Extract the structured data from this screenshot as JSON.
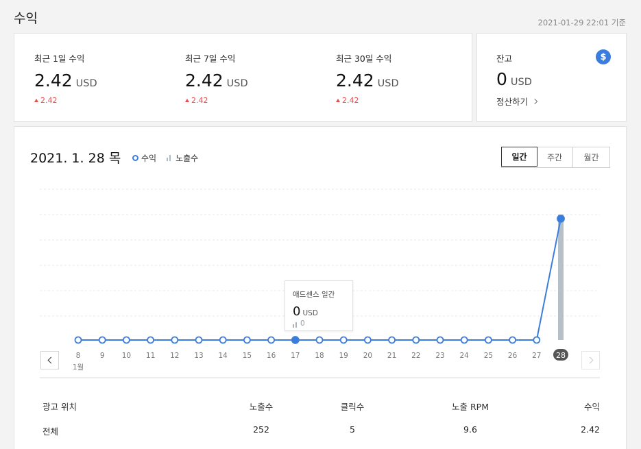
{
  "header": {
    "title": "수익",
    "timestamp": "2021-01-29 22:01 기준"
  },
  "summary": [
    {
      "label": "최근 1일 수익",
      "value": "2.42",
      "unit": "USD",
      "delta": "2.42"
    },
    {
      "label": "최근 7일 수익",
      "value": "2.42",
      "unit": "USD",
      "delta": "2.42"
    },
    {
      "label": "최근 30일 수익",
      "value": "2.42",
      "unit": "USD",
      "delta": "2.42"
    }
  ],
  "balance": {
    "label": "잔고",
    "value": "0",
    "unit": "USD",
    "settle_label": "정산하기",
    "icon": "dollar-icon",
    "icon_glyph": "$"
  },
  "chart_header": {
    "date": "2021. 1. 28 목",
    "legend_revenue": "수익",
    "legend_impressions": "노출수",
    "tabs": [
      {
        "label": "일간",
        "active": true
      },
      {
        "label": "주간",
        "active": false
      },
      {
        "label": "월간",
        "active": false
      }
    ]
  },
  "tooltip": {
    "title": "애드센스 일간",
    "value": "0",
    "unit": "USD",
    "impressions": "0"
  },
  "chart_data": {
    "type": "line",
    "x": [
      "8",
      "9",
      "10",
      "11",
      "12",
      "13",
      "14",
      "15",
      "16",
      "17",
      "18",
      "19",
      "20",
      "21",
      "22",
      "23",
      "24",
      "25",
      "26",
      "27",
      "28"
    ],
    "x_sublabel": "1월",
    "series": [
      {
        "name": "수익",
        "values": [
          0,
          0,
          0,
          0,
          0,
          0,
          0,
          0,
          0,
          0,
          0,
          0,
          0,
          0,
          0,
          0,
          0,
          0,
          0,
          0,
          2.42
        ]
      },
      {
        "name": "노출수",
        "values": [
          0,
          0,
          0,
          0,
          0,
          0,
          0,
          0,
          0,
          0,
          0,
          0,
          0,
          0,
          0,
          0,
          0,
          0,
          0,
          0,
          252
        ]
      }
    ],
    "highlighted_x": "17",
    "selected_x": "28",
    "grid": true,
    "colors": {
      "line": "#3b7ddd",
      "bar": "#b6c0c8",
      "selected_label_bg": "#555555"
    }
  },
  "table": {
    "headers": [
      "광고 위치",
      "노출수",
      "클릭수",
      "노출 RPM",
      "수익"
    ],
    "rows": [
      [
        "전체",
        "252",
        "5",
        "9.6",
        "2.42"
      ]
    ]
  }
}
